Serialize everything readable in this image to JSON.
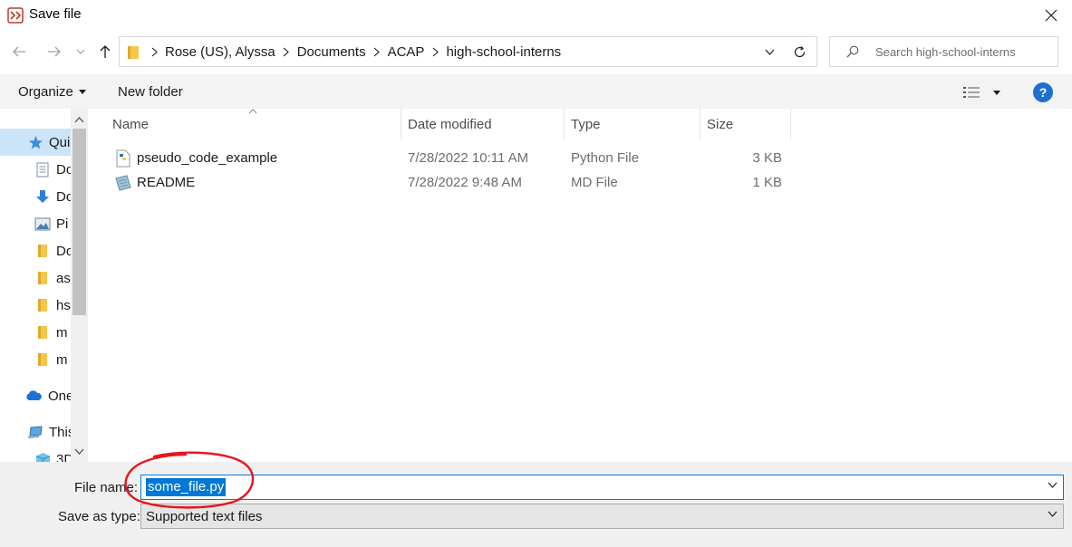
{
  "window": {
    "title": "Save file"
  },
  "address": {
    "crumbs": [
      "Rose (US), Alyssa",
      "Documents",
      "ACAP",
      "high-school-interns"
    ]
  },
  "search": {
    "placeholder": "Search high-school-interns"
  },
  "toolbar": {
    "organize_label": "Organize",
    "new_folder_label": "New folder",
    "help_label": "?"
  },
  "sidebar": {
    "items": [
      {
        "label": "Qui",
        "icon": "star-icon"
      },
      {
        "label": "Do",
        "icon": "documents-icon"
      },
      {
        "label": "Do",
        "icon": "download-icon"
      },
      {
        "label": "Pi",
        "icon": "pictures-icon"
      },
      {
        "label": "Do",
        "icon": "folder-icon"
      },
      {
        "label": "as",
        "icon": "folder-icon"
      },
      {
        "label": "hs",
        "icon": "folder-icon"
      },
      {
        "label": "m",
        "icon": "folder-icon"
      },
      {
        "label": "m",
        "icon": "folder-icon"
      },
      {
        "label": "One",
        "icon": "onedrive-icon"
      },
      {
        "label": "This",
        "icon": "this-pc-icon"
      },
      {
        "label": "3D",
        "icon": "3d-objects-icon"
      }
    ]
  },
  "columns": {
    "name": "Name",
    "date": "Date modified",
    "type": "Type",
    "size": "Size"
  },
  "files": [
    {
      "name": "pseudo_code_example",
      "date": "7/28/2022 10:11 AM",
      "type": "Python File",
      "size": "3 KB",
      "icon": "python-file-icon"
    },
    {
      "name": "README",
      "date": "7/28/2022 9:48 AM",
      "type": "MD File",
      "size": "1 KB",
      "icon": "md-file-icon"
    }
  ],
  "footer": {
    "file_name_label": "File name:",
    "file_name_value": "some_file.py",
    "save_type_label": "Save as type:",
    "save_type_value": "Supported text files"
  },
  "colors": {
    "accent": "#0078d7",
    "selection": "#cce4f7",
    "annotation": "#e8141e"
  }
}
